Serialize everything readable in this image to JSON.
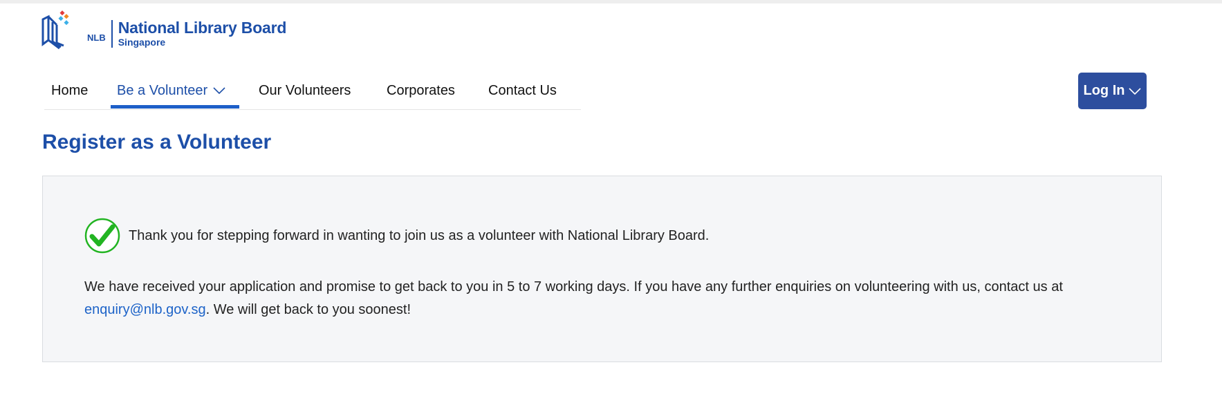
{
  "logo": {
    "abbr": "NLB",
    "name": "National Library Board",
    "sub": "Singapore"
  },
  "nav": {
    "items": [
      {
        "label": "Home"
      },
      {
        "label": "Be a Volunteer",
        "active": true
      },
      {
        "label": "Our Volunteers"
      },
      {
        "label": "Corporates"
      },
      {
        "label": "Contact Us"
      }
    ]
  },
  "login": {
    "label": "Log In"
  },
  "page": {
    "title": "Register as a Volunteer"
  },
  "confirmation": {
    "thank_you": "Thank you for stepping forward in wanting to join us as a volunteer with National Library Board.",
    "message_before": "We have received your application and promise to get back to you in 5 to 7 working days. If you have any further enquiries on volunteering with us, contact us at ",
    "email": "enquiry@nlb.gov.sg",
    "message_after": ". We will get back to you soonest!"
  },
  "colors": {
    "brand_blue": "#1d4fa8",
    "login_bg": "#2d4e9e",
    "active_underline": "#1d5fc8",
    "check_green": "#22b422",
    "panel_bg": "#f5f6f8",
    "link": "#1d63c8"
  },
  "icons": {
    "logo": "nlb-book-logo-icon",
    "dropdown": "chevron-down-icon",
    "success": "check-circle-icon"
  }
}
